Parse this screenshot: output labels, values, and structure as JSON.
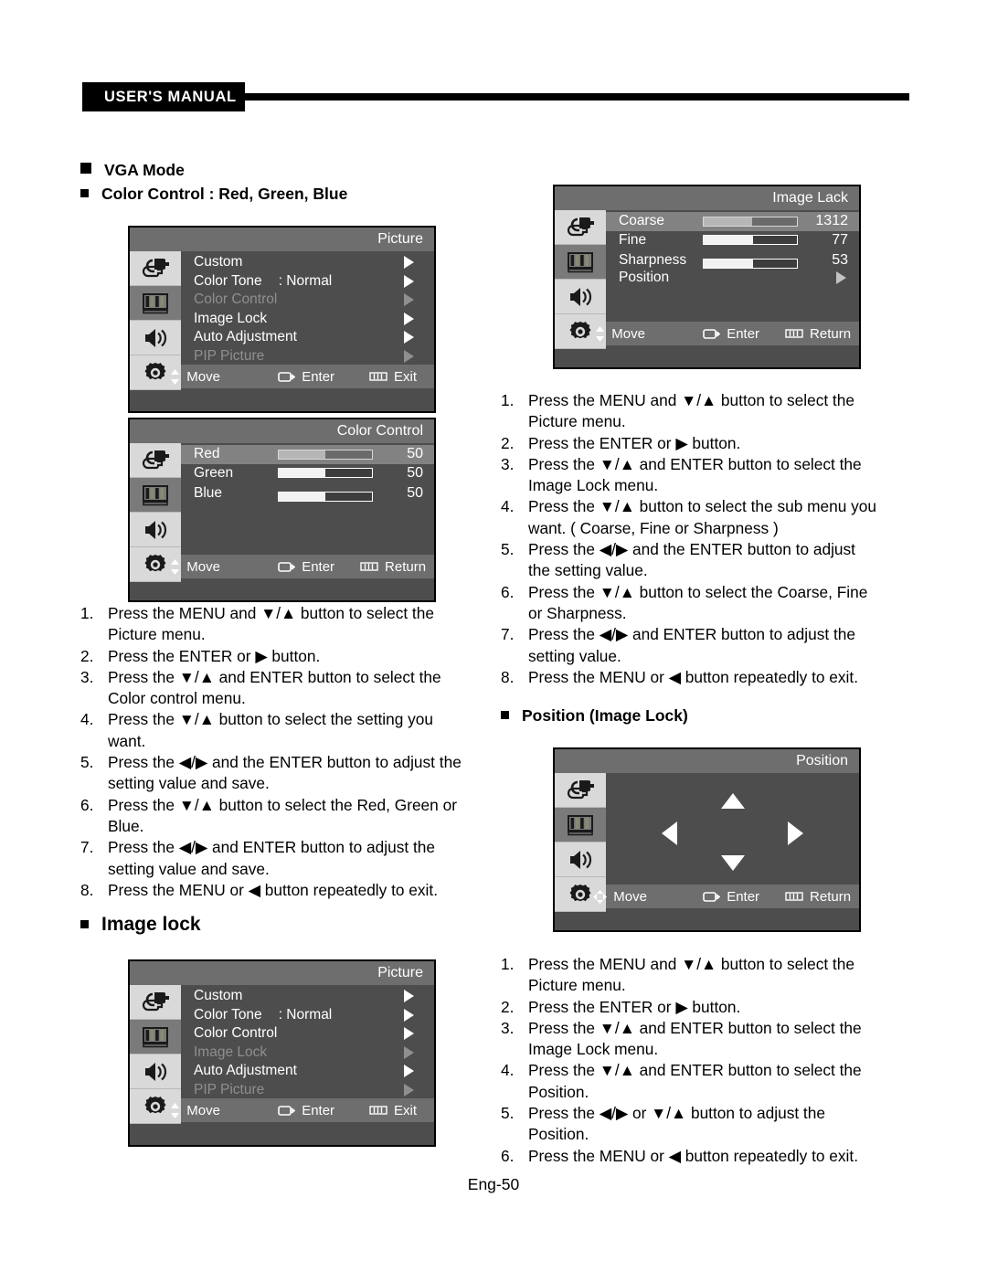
{
  "header": {
    "tab_label": "USER'S MANUAL"
  },
  "headings": {
    "vga_mode": "VGA Mode",
    "color_control": "Color Control : Red, Green, Blue",
    "image_lock": "Image lock",
    "position_image_lock": "Position (Image Lock)"
  },
  "osd_common": {
    "move": "Move",
    "enter": "Enter",
    "exit": "Exit",
    "return": "Return",
    "icons": {
      "input": "input-plug-icon",
      "picture": "picture-colorbars-icon",
      "sound": "speaker-icon",
      "setup": "gear-icon",
      "move": "up-down-arrows-icon",
      "move_pad": "four-way-arrows-icon",
      "enter": "enter-key-icon",
      "exit": "menu-bars-icon"
    }
  },
  "picture_menu_1": {
    "title": "Picture",
    "items": [
      {
        "label": "Custom",
        "value": "",
        "state": "normal"
      },
      {
        "label": "Color Tone",
        "value": ": Normal",
        "state": "normal"
      },
      {
        "label": "Color Control",
        "value": "",
        "state": "dim"
      },
      {
        "label": "Image Lock",
        "value": "",
        "state": "normal"
      },
      {
        "label": "Auto Adjustment",
        "value": "",
        "state": "normal"
      },
      {
        "label": "PIP Picture",
        "value": "",
        "state": "dim"
      }
    ],
    "bottom": {
      "move": "Move",
      "enter": "Enter",
      "right": "Exit"
    }
  },
  "color_control_menu": {
    "title": "Color Control",
    "items": [
      {
        "label": "Red",
        "value": "50",
        "fill_pct": 50,
        "selected": true
      },
      {
        "label": "Green",
        "value": "50",
        "fill_pct": 50,
        "selected": false
      },
      {
        "label": "Blue",
        "value": "50",
        "fill_pct": 50,
        "selected": false
      }
    ],
    "bottom": {
      "move": "Move",
      "enter": "Enter",
      "right": "Return"
    }
  },
  "image_lock_menu": {
    "title": "Image Lack",
    "items": [
      {
        "label": "Coarse",
        "value": "1312",
        "fill_pct": 52,
        "selected": true,
        "caret": false
      },
      {
        "label": "Fine",
        "value": "77",
        "fill_pct": 53,
        "selected": false,
        "caret": false
      },
      {
        "label": "Sharpness",
        "value": "53",
        "fill_pct": 53,
        "selected": false,
        "caret": false
      },
      {
        "label": "Position",
        "value": "",
        "fill_pct": 0,
        "selected": false,
        "caret": true
      }
    ],
    "bottom": {
      "move": "Move",
      "enter": "Enter",
      "right": "Return"
    }
  },
  "picture_menu_2": {
    "title": "Picture",
    "items": [
      {
        "label": "Custom",
        "value": "",
        "state": "normal"
      },
      {
        "label": "Color Tone",
        "value": ": Normal",
        "state": "normal"
      },
      {
        "label": "Color Control",
        "value": "",
        "state": "normal"
      },
      {
        "label": "Image Lock",
        "value": "",
        "state": "dim"
      },
      {
        "label": "Auto Adjustment",
        "value": "",
        "state": "normal"
      },
      {
        "label": "PIP Picture",
        "value": "",
        "state": "dim"
      }
    ],
    "bottom": {
      "move": "Move",
      "enter": "Enter",
      "right": "Exit"
    }
  },
  "position_menu": {
    "title": "Position",
    "bottom": {
      "move": "Move",
      "enter": "Enter",
      "right": "Return"
    }
  },
  "steps_color_control": [
    {
      "n": "1.",
      "t": "Press the MENU and ▼/▲ button to select the Picture menu."
    },
    {
      "n": "2.",
      "t": "Press the ENTER or ▶ button."
    },
    {
      "n": "3.",
      "t": "Press the ▼/▲ and ENTER button to select the Color control menu."
    },
    {
      "n": "4.",
      "t": "Press the ▼/▲ button to select the setting you want."
    },
    {
      "n": "5.",
      "t": "Press the ◀/▶ and the ENTER button to adjust the setting value and save."
    },
    {
      "n": "6.",
      "t": "Press the ▼/▲ button to select the Red, Green or Blue."
    },
    {
      "n": "7.",
      "t": "Press the ◀/▶ and ENTER button to adjust the setting value and save."
    },
    {
      "n": "8.",
      "t": "Press the MENU or ◀ button repeatedly to exit."
    }
  ],
  "steps_image_lock": [
    {
      "n": "1.",
      "t": "Press the MENU and ▼/▲ button to select the Picture menu."
    },
    {
      "n": "2.",
      "t": "Press the ENTER or ▶ button."
    },
    {
      "n": "3.",
      "t": "Press the ▼/▲ and ENTER button to select the Image Lock menu."
    },
    {
      "n": "4.",
      "t": "Press the ▼/▲ button to select the sub menu you want. ( Coarse, Fine or Sharpness )"
    },
    {
      "n": "5.",
      "t": "Press the ◀/▶ and the ENTER button to adjust the setting value."
    },
    {
      "n": "6.",
      "t": "Press the ▼/▲ button to select the Coarse, Fine or Sharpness."
    },
    {
      "n": "7.",
      "t": "Press the ◀/▶ and ENTER button to adjust the setting value."
    },
    {
      "n": "8.",
      "t": "Press the MENU or ◀ button repeatedly to exit."
    }
  ],
  "steps_position": [
    {
      "n": "1.",
      "t": "Press the MENU and ▼/▲ button to select the Picture menu."
    },
    {
      "n": "2.",
      "t": "Press  the ENTER or ▶ button."
    },
    {
      "n": "3.",
      "t": "Press  the ▼/▲ and ENTER button to select the Image Lock menu."
    },
    {
      "n": "4.",
      "t": "Press the ▼/▲ and ENTER button to select the Position."
    },
    {
      "n": "5.",
      "t": "Press the ◀/▶ or  ▼/▲  button to adjust the Position."
    },
    {
      "n": "6.",
      "t": "Press the MENU or ◀ button repeatedly to exit."
    }
  ],
  "footer": {
    "page": "Eng-50"
  }
}
